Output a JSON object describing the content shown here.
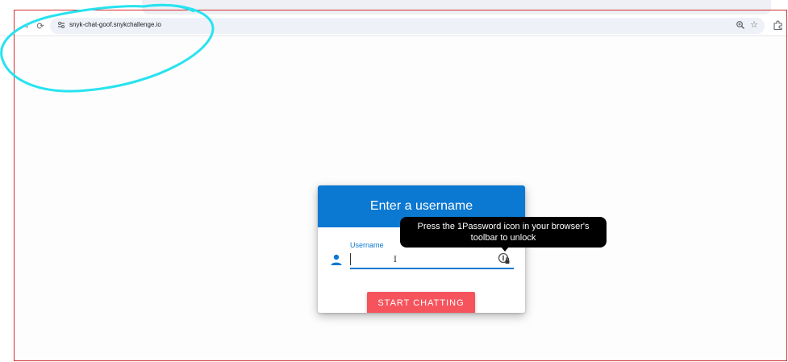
{
  "browser": {
    "url": "snyk-chat-goof.snykchallenge.io",
    "forward_icon": "→",
    "reload_icon": "⟳",
    "bookmark_icon": "☆"
  },
  "card": {
    "title": "Enter a username",
    "username_label": "Username",
    "username_value": "",
    "start_button_label": "START CHATTING"
  },
  "tooltip": {
    "text": "Press the 1Password icon in your browser's toolbar to unlock"
  },
  "colors": {
    "accent": "#0b78d1",
    "button": "#f6545d",
    "annotation": "#27e3ef",
    "frame": "#d32f2f"
  }
}
